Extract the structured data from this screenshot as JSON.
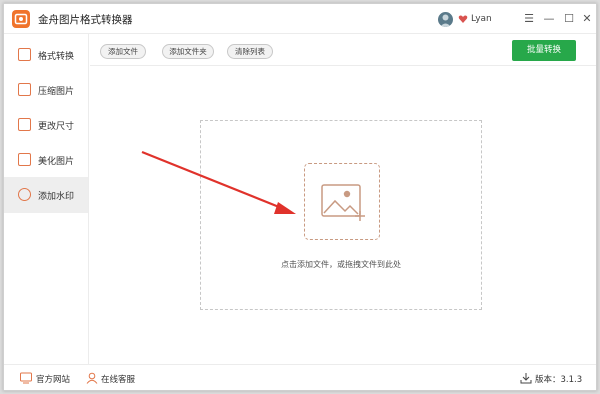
{
  "app": {
    "title": "金舟图片格式转换器",
    "username": "Lyan",
    "accent": "#f0742c",
    "green": "#27a84a"
  },
  "window_controls": {
    "menu": "☰",
    "minimize": "—",
    "maximize": "☐",
    "close": "✕"
  },
  "sidebar": {
    "items": [
      {
        "label": "格式转换",
        "icon": "format-convert-icon"
      },
      {
        "label": "压缩图片",
        "icon": "compress-icon"
      },
      {
        "label": "更改尺寸",
        "icon": "resize-icon"
      },
      {
        "label": "美化图片",
        "icon": "beautify-icon"
      },
      {
        "label": "添加水印",
        "icon": "watermark-icon",
        "active": true
      }
    ]
  },
  "toolbar": {
    "add_file": "添加文件",
    "add_folder": "添加文件夹",
    "clear_list": "清除列表",
    "batch_convert": "批量转换"
  },
  "main": {
    "drop_hint": "点击添加文件，或拖拽文件到此处"
  },
  "footer": {
    "website": "官方网站",
    "support": "在线客服",
    "version": "版本：3.1.3"
  }
}
